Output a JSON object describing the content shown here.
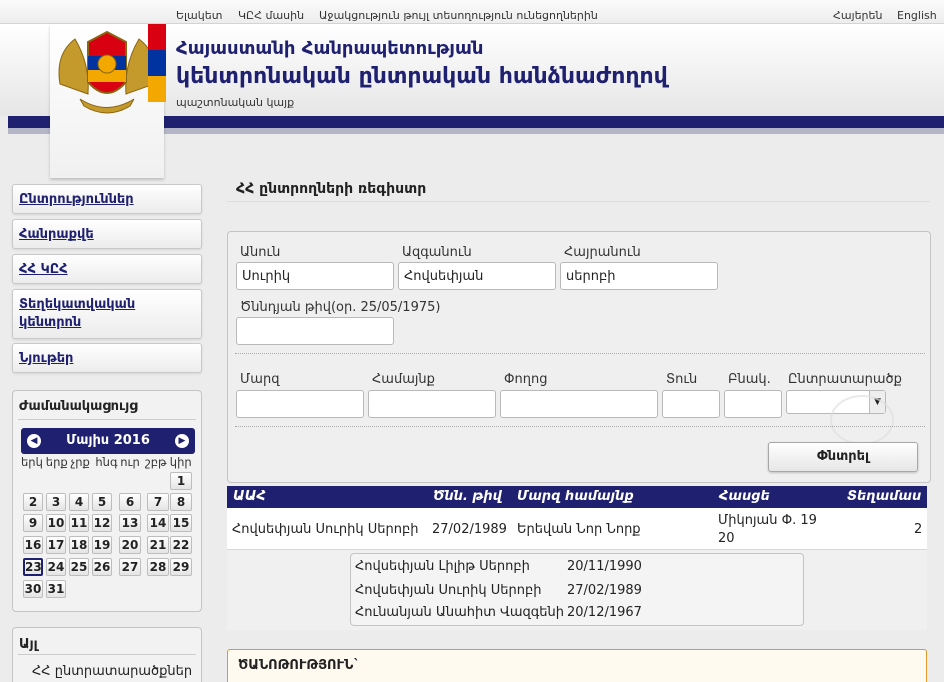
{
  "topnav": {
    "links": [
      "Ելակետ",
      "ԿԸՀ մասին",
      "Աջակցություն թույլ տեսողություն ունեցողներին"
    ],
    "lang_hy": "Հայերեն",
    "lang_en": "English"
  },
  "header": {
    "line1": "Հայաստանի Հանրապետության",
    "line2": "կենտրոնական ընտրական հանձնաժողով",
    "tagline": "պաշտոնական կայք"
  },
  "flag_colors": [
    "#d90012",
    "#0033a0",
    "#f2a800"
  ],
  "sidebar": {
    "items": [
      "Ընտրություններ",
      "Հանրաքվե",
      "ՀՀ ԿԸՀ",
      "Տեղեկատվական կենտրոն",
      "Նյութեր"
    ],
    "calendar_title": "Ժամանակացույց",
    "calendar_month": "Մայիս 2016",
    "weekdays": [
      "երկ",
      "երք",
      "չրք",
      "հնգ",
      "ուր",
      "շբթ",
      "կիր"
    ],
    "days": [
      "1",
      "2",
      "3",
      "4",
      "5",
      "6",
      "7",
      "8",
      "9",
      "10",
      "11",
      "12",
      "13",
      "14",
      "15",
      "16",
      "17",
      "18",
      "19",
      "20",
      "21",
      "22",
      "23",
      "24",
      "25",
      "26",
      "27",
      "28",
      "29",
      "30",
      "31"
    ],
    "other_title": "Այլ",
    "other_link": "ՀՀ ընտրատարածքներ"
  },
  "main": {
    "title": "ՀՀ ընտրողների ռեգիստր",
    "form": {
      "first_name_label": "Անուն",
      "first_name_value": "Սուրիկ",
      "last_name_label": "Ազգանուն",
      "last_name_value": "Հովսեփյան",
      "patronymic_label": "Հայրանուն",
      "patronymic_value": "սերոբի",
      "birth_label": "Ծննդյան թիվ(օր. 25/05/1975)",
      "birth_value": "",
      "region_label": "Մարզ",
      "community_label": "Համայնք",
      "street_label": "Փողոց",
      "house_label": "Տուն",
      "apt_label": "Բնակ.",
      "district_label": "Ընտրատարածք",
      "search_button": "Փնտրել"
    },
    "table": {
      "headers": [
        "ԱԱՀ",
        "Ծնն. թիվ",
        "Մարզ համայնք",
        "Հասցե",
        "Տեղամաս"
      ],
      "row": {
        "name": "Հովսեփյան Սուրիկ Սերոբի",
        "dob": "27/02/1989",
        "region": "Երեվան Նոր Նորք",
        "address1": "Միկոյան Փ. 19",
        "address2": "20",
        "precinct": "2"
      },
      "family": [
        {
          "name": "Հովսեփյան Լիլիթ Սերոբի",
          "dob": "20/11/1990"
        },
        {
          "name": "Հովսեփյան Սուրիկ Սերոբի",
          "dob": "27/02/1989"
        },
        {
          "name": "Հունանյան Անահիտ Վազգենի",
          "dob": "20/12/1967"
        }
      ]
    },
    "notice_title": "ԾԱՆՈԹՈՒԹՅՈՒՆ`"
  }
}
